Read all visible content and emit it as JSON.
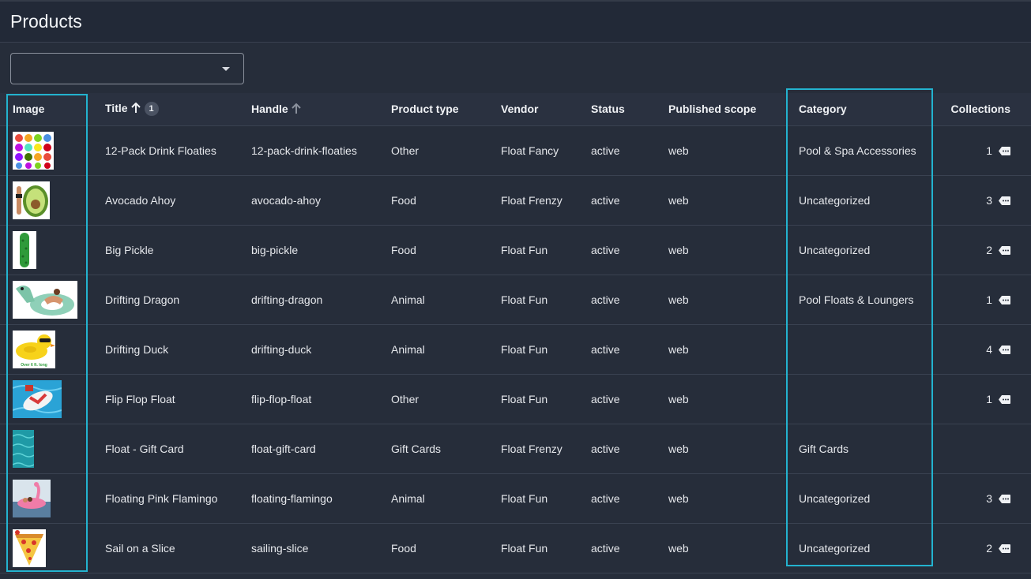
{
  "app": {
    "title": "Products"
  },
  "filter": {
    "value": ""
  },
  "table": {
    "columns": [
      {
        "key": "image",
        "label": "Image"
      },
      {
        "key": "title",
        "label": "Title",
        "sort": "asc",
        "sort_index": "1"
      },
      {
        "key": "handle",
        "label": "Handle",
        "sort": "asc"
      },
      {
        "key": "product_type",
        "label": "Product type"
      },
      {
        "key": "vendor",
        "label": "Vendor"
      },
      {
        "key": "status",
        "label": "Status"
      },
      {
        "key": "published_scope",
        "label": "Published scope"
      },
      {
        "key": "category",
        "label": "Category"
      },
      {
        "key": "collections",
        "label": "Collections"
      }
    ],
    "rows": [
      {
        "image": "drink-floaties-thumbnail",
        "title": "12-Pack Drink Floaties",
        "handle": "12-pack-drink-floaties",
        "product_type": "Other",
        "vendor": "Float Fancy",
        "status": "active",
        "published_scope": "web",
        "category": "Pool & Spa Accessories",
        "collections": "1"
      },
      {
        "image": "avocado-thumbnail",
        "title": "Avocado Ahoy",
        "handle": "avocado-ahoy",
        "product_type": "Food",
        "vendor": "Float Frenzy",
        "status": "active",
        "published_scope": "web",
        "category": "Uncategorized",
        "collections": "3"
      },
      {
        "image": "pickle-thumbnail",
        "title": "Big Pickle",
        "handle": "big-pickle",
        "product_type": "Food",
        "vendor": "Float Fun",
        "status": "active",
        "published_scope": "web",
        "category": "Uncategorized",
        "collections": "2"
      },
      {
        "image": "dragon-thumbnail",
        "title": "Drifting Dragon",
        "handle": "drifting-dragon",
        "product_type": "Animal",
        "vendor": "Float Fun",
        "status": "active",
        "published_scope": "web",
        "category": "Pool Floats & Loungers",
        "collections": "1"
      },
      {
        "image": "duck-thumbnail",
        "title": "Drifting Duck",
        "handle": "drifting-duck",
        "product_type": "Animal",
        "vendor": "Float Fun",
        "status": "active",
        "published_scope": "web",
        "category": "",
        "collections": "4",
        "thumb_caption": "Over 6 ft. long"
      },
      {
        "image": "flip-flop-thumbnail",
        "title": "Flip Flop Float",
        "handle": "flip-flop-float",
        "product_type": "Other",
        "vendor": "Float Fun",
        "status": "active",
        "published_scope": "web",
        "category": "",
        "collections": "1"
      },
      {
        "image": "water-thumbnail",
        "title": "Float - Gift Card",
        "handle": "float-gift-card",
        "product_type": "Gift Cards",
        "vendor": "Float Frenzy",
        "status": "active",
        "published_scope": "web",
        "category": "Gift Cards",
        "collections": ""
      },
      {
        "image": "flamingo-thumbnail",
        "title": "Floating Pink Flamingo",
        "handle": "floating-flamingo",
        "product_type": "Animal",
        "vendor": "Float Fun",
        "status": "active",
        "published_scope": "web",
        "category": "Uncategorized",
        "collections": "3"
      },
      {
        "image": "pizza-slice-thumbnail",
        "title": "Sail on a Slice",
        "handle": "sailing-slice",
        "product_type": "Food",
        "vendor": "Float Fun",
        "status": "active",
        "published_scope": "web",
        "category": "Uncategorized",
        "collections": "2"
      }
    ]
  },
  "colors": {
    "background": "#262d3a",
    "header_bar": "#222937",
    "highlight": "#23b3cf",
    "text": "#e6e8ec"
  }
}
